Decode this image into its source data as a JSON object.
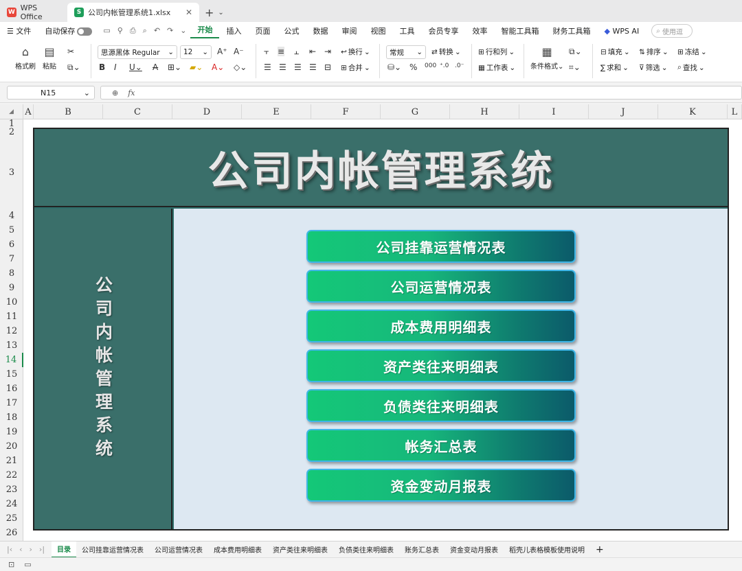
{
  "titlebar": {
    "home_tab": "WPS Office",
    "file_tab": "公司内帐管理系统1.xlsx",
    "new_tab": "+"
  },
  "menu": {
    "file": "文件",
    "autosave": "自动保存",
    "items": [
      "开始",
      "插入",
      "页面",
      "公式",
      "数据",
      "审阅",
      "视图",
      "工具",
      "会员专享",
      "效率",
      "智能工具箱",
      "财务工具箱",
      "WPS AI"
    ],
    "active": "开始",
    "search_placeholder": "使用逗"
  },
  "ribbon": {
    "format_painter": "格式刷",
    "paste": "粘贴",
    "font_name": "思源黑体 Regular",
    "font_size": "12",
    "wrap": "换行",
    "merge": "合并",
    "number_format": "常规",
    "convert": "转换",
    "row_col": "行和列",
    "worksheet": "工作表",
    "cond_format": "条件格式",
    "fill": "填充",
    "sort": "排序",
    "freeze": "冻结",
    "sum": "求和",
    "filter": "筛选",
    "find": "查找"
  },
  "formula_bar": {
    "name_box": "N15",
    "fx": "fx",
    "value": ""
  },
  "columns": [
    "A",
    "B",
    "C",
    "D",
    "E",
    "F",
    "G",
    "H",
    "I",
    "J",
    "K",
    "L"
  ],
  "rows": [
    "1",
    "2",
    "3",
    "4",
    "5",
    "6",
    "7",
    "8",
    "9",
    "10",
    "11",
    "12",
    "13",
    "14",
    "15",
    "16",
    "17",
    "18",
    "19",
    "20",
    "21",
    "22",
    "23",
    "24",
    "25",
    "26"
  ],
  "selected_row": "15",
  "dashboard": {
    "title": "公司内帐管理系统",
    "side_title": "公司内帐管理系统",
    "buttons": [
      "公司挂靠运营情况表",
      "公司运营情况表",
      "成本费用明细表",
      "资产类往来明细表",
      "负债类往来明细表",
      "帐务汇总表",
      "资金变动月报表"
    ]
  },
  "sheet_tabs": [
    "目录",
    "公司挂靠运营情况表",
    "公司运营情况表",
    "成本费用明细表",
    "资产类往来明细表",
    "负债类往来明细表",
    "账务汇总表",
    "资金变动月报表",
    "稻壳儿表格模板使用说明"
  ],
  "active_sheet": "目录",
  "colors": {
    "accent": "#1a8a4a",
    "panel": "#3a6f6a",
    "main_bg": "#dde8f2",
    "button_from": "#14c878",
    "button_to": "#0b5a6a"
  }
}
